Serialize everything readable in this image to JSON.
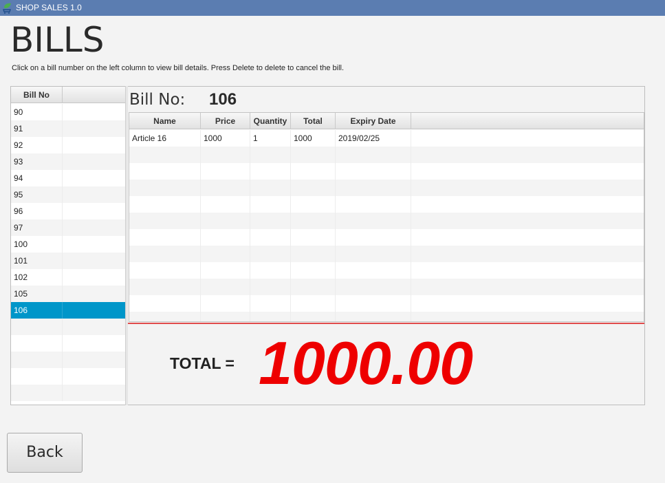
{
  "window": {
    "title": "SHOP SALES 1.0",
    "icon": "leaf-cart-icon"
  },
  "page": {
    "title": "BILLS",
    "instructions": "Click on a bill number on the left column to view bill details. Press Delete to delete to cancel the bill."
  },
  "bill_list": {
    "column_header": "Bill No",
    "items": [
      "90",
      "91",
      "92",
      "93",
      "94",
      "95",
      "96",
      "97",
      "100",
      "101",
      "102",
      "105",
      "106"
    ],
    "selected": "106",
    "empty_rows": 5
  },
  "detail": {
    "bill_no_label": "Bill No:",
    "bill_no_value": "106",
    "columns": [
      "Name",
      "Price",
      "Quantity",
      "Total",
      "Expiry Date"
    ],
    "rows": [
      [
        "Article 16",
        "1000",
        "1",
        "1000",
        "2019/02/25"
      ]
    ],
    "empty_rows": 11,
    "total_label": "TOTAL =",
    "total_value": "1000.00"
  },
  "actions": {
    "back_label": "Back"
  },
  "colors": {
    "titlebar": "#5b7db1",
    "selection": "#0096c9",
    "total_value": "#ee0000",
    "separator": "#e04b4b"
  }
}
